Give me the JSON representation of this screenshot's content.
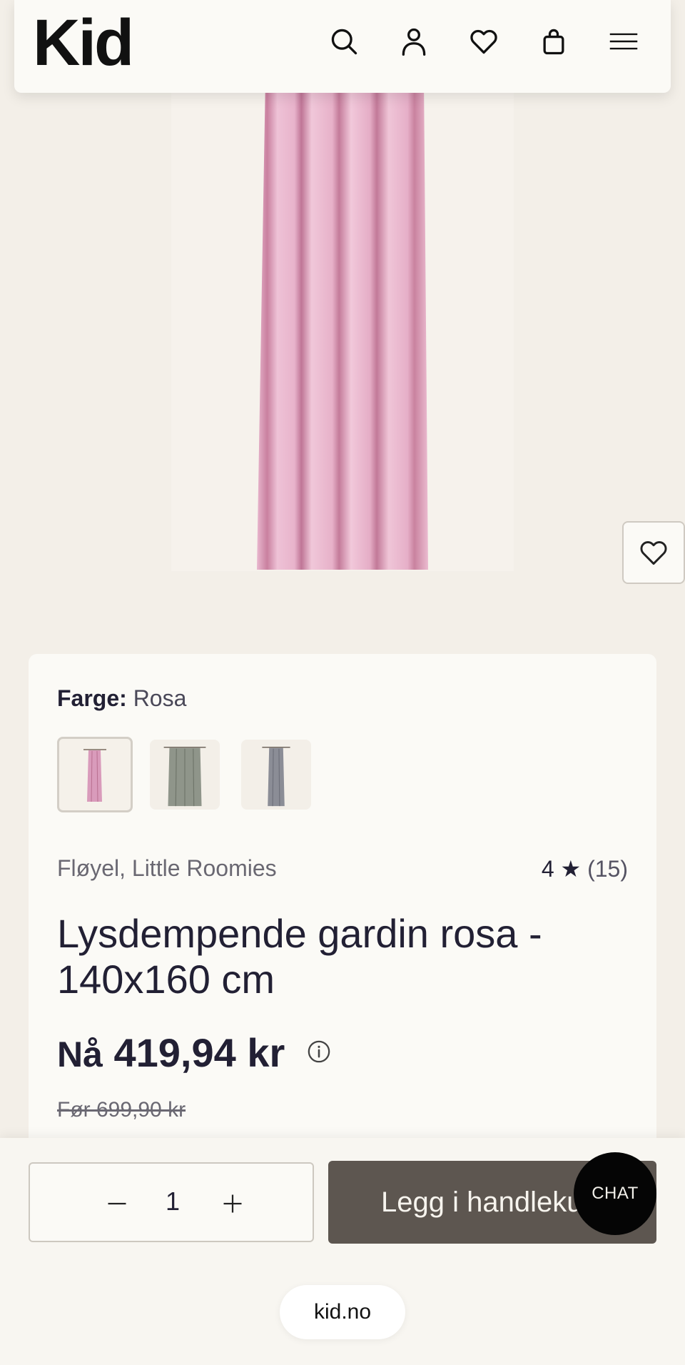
{
  "header": {
    "logo_text": "Kid",
    "icons": [
      "search-icon",
      "account-icon",
      "wishlist-icon",
      "bag-icon",
      "menu-icon"
    ]
  },
  "product_image": {
    "alt": "Lysdempende gardin rosa",
    "favorite_icon": "heart-icon"
  },
  "product": {
    "color_label": "Farge:",
    "color_value": "Rosa",
    "swatches": [
      {
        "name": "Rosa",
        "color": "#d99bbb",
        "selected": true
      },
      {
        "name": "Grønn",
        "color": "#8f958a",
        "selected": false
      },
      {
        "name": "Grå",
        "color": "#8b8d96",
        "selected": false
      }
    ],
    "brand": "Fløyel, Little Roomies",
    "rating_value": "4",
    "rating_star": "★",
    "rating_count": "(15)",
    "title": "Lysdempende gardin rosa - 140x160 cm",
    "price_prefix": "Nå",
    "price": "419,94 kr",
    "old_price": "Før 699,90 kr"
  },
  "cart": {
    "quantity": "1",
    "add_button_label": "Legg i handlekurv",
    "chat_label": "CHAT"
  },
  "footer": {
    "domain": "kid.no"
  },
  "colors": {
    "background": "#f3efe8",
    "card": "#fbfaf6",
    "button": "#5d5650",
    "text": "#222034"
  }
}
